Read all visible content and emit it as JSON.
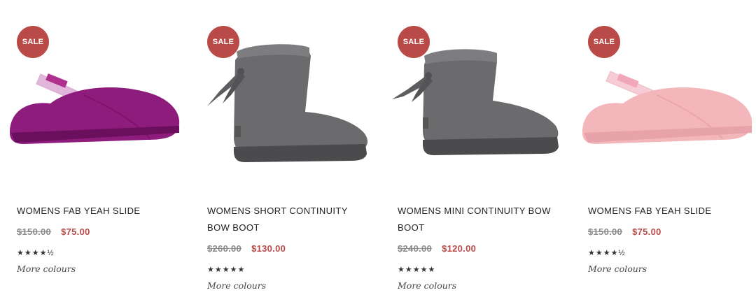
{
  "products": [
    {
      "sale_badge": "SALE",
      "name": "WOMENS FAB YEAH SLIDE",
      "price_was": "$150.00",
      "price_now": "$75.00",
      "rating": "★★★★½",
      "more": "More colours",
      "image_icon": "slide-sandal-icon",
      "color": "#8e1c7c"
    },
    {
      "sale_badge": "SALE",
      "name": "WOMENS SHORT CONTINUITY BOW BOOT",
      "price_was": "$260.00",
      "price_now": "$130.00",
      "rating": "★★★★★",
      "more": "More colours",
      "image_icon": "boot-icon",
      "color": "#6b6b6e"
    },
    {
      "sale_badge": "SALE",
      "name": "WOMENS MINI CONTINUITY BOW BOOT",
      "price_was": "$240.00",
      "price_now": "$120.00",
      "rating": "★★★★★",
      "more": "More colours",
      "image_icon": "boot-icon",
      "color": "#6b6b6e"
    },
    {
      "sale_badge": "SALE",
      "name": "WOMENS FAB YEAH SLIDE",
      "price_was": "$150.00",
      "price_now": "$75.00",
      "rating": "★★★★½",
      "more": "More colours",
      "image_icon": "slide-sandal-icon",
      "color": "#f3b6ba"
    }
  ],
  "colors": {
    "sale": "#b94a48",
    "price_now": "#b94a48",
    "price_was": "#8a8a8a"
  }
}
